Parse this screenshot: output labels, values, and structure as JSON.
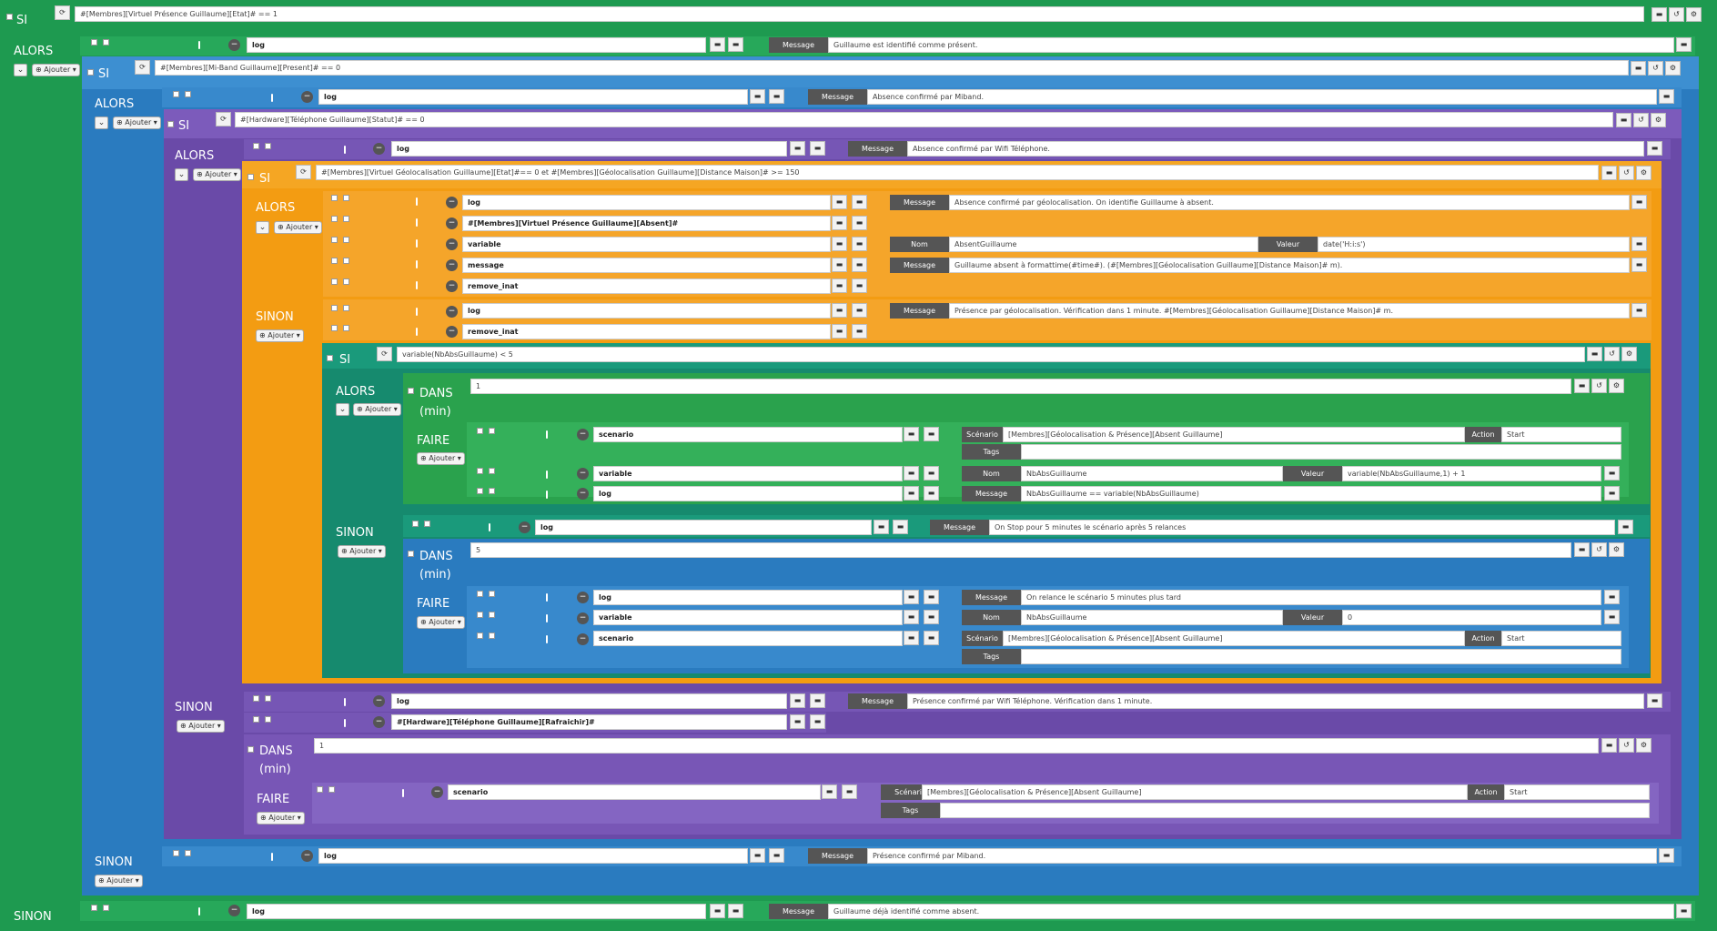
{
  "si": "SI",
  "alors": "ALORS",
  "sinon": "SINON",
  "dans": "DANS",
  "min": "(min)",
  "faire": "FAIRE",
  "ajouter": "Ajouter",
  "lbl_message": "Message",
  "lbl_nom": "Nom",
  "lbl_valeur": "Valeur",
  "lbl_scenario": "Scénario",
  "lbl_action": "Action",
  "lbl_tags": "Tags",
  "colors": {
    "green": "#1e9a50",
    "blue": "#2a7bbf",
    "purple": "#6a4aa8",
    "orange": "#f39c12",
    "teal": "#168a6e",
    "green2": "#2aa24d"
  },
  "icons": [
    "refresh-icon",
    "minus-circle-icon",
    "drag-handle-icon",
    "comment-icon",
    "copy-icon",
    "undo-icon",
    "settings-icon",
    "chevron-down-icon",
    "caret-down-icon"
  ],
  "c1": {
    "cond": "#[Membres][Virtuel Présence Guillaume][Etat]# == 1",
    "a1_cmd": "log",
    "a1_msg": "Guillaume est identifié comme présent.",
    "sinon_cmd": "log",
    "sinon_msg": "Guillaume déjà identifié comme absent."
  },
  "c2": {
    "cond": "#[Membres][Mi-Band Guillaume][Present]# == 0",
    "a1_cmd": "log",
    "a1_msg": "Absence confirmé par Miband.",
    "sinon_cmd": "log",
    "sinon_msg": "Présence confirmé par Miband."
  },
  "c3": {
    "cond": "#[Hardware][Téléphone Guillaume][Statut]# == 0",
    "a1_cmd": "log",
    "a1_msg": "Absence confirmé par Wifi Téléphone.",
    "s1_cmd": "log",
    "s1_msg": "Présence confirmé par Wifi Téléphone. Vérification dans 1 minute.",
    "s2_cmd": "#[Hardware][Téléphone Guillaume][Rafraichir]#",
    "dans": "1",
    "f_cmd": "scenario",
    "f_scen": "[Membres][Géolocalisation & Présence][Absent Guillaume]",
    "f_action": "Start"
  },
  "c4": {
    "cond": "#[Membres][Virtuel Géolocalisation Guillaume][Etat]#== 0 et #[Membres][Géolocalisation Guillaume][Distance Maison]# >= 150",
    "a1_cmd": "log",
    "a1_msg": "Absence confirmé par géolocalisation. On identifie Guillaume à absent.",
    "a2_cmd": "#[Membres][Virtuel Présence Guillaume][Absent]#",
    "a3_cmd": "variable",
    "a3_nom": "AbsentGuillaume",
    "a3_val": "date('H:i:s')",
    "a4_cmd": "message",
    "a4_msg": "Guillaume absent à formattime(#time#). (#[Membres][Géolocalisation Guillaume][Distance Maison]# m).",
    "a5_cmd": "remove_inat",
    "s1_cmd": "log",
    "s1_msg": "Présence par géolocalisation. Vérification dans 1 minute. #[Membres][Géolocalisation Guillaume][Distance Maison]# m.",
    "s2_cmd": "remove_inat"
  },
  "c5": {
    "cond": "variable(NbAbsGuillaume) < 5",
    "dans1": "1",
    "f1_cmd": "scenario",
    "f1_scen": "[Membres][Géolocalisation & Présence][Absent Guillaume]",
    "f1_action": "Start",
    "f2_cmd": "variable",
    "f2_nom": "NbAbsGuillaume",
    "f2_val": "variable(NbAbsGuillaume,1) + 1",
    "f3_cmd": "log",
    "f3_msg": "NbAbsGuillaume == variable(NbAbsGuillaume)",
    "s_cmd": "log",
    "s_msg": "On Stop pour 5 minutes le scénario après 5 relances",
    "dans2": "5",
    "g1_cmd": "log",
    "g1_msg": "On relance le scénario 5 minutes plus tard",
    "g2_cmd": "variable",
    "g2_nom": "NbAbsGuillaume",
    "g2_val": "0",
    "g3_cmd": "scenario",
    "g3_scen": "[Membres][Géolocalisation & Présence][Absent Guillaume]",
    "g3_action": "Start"
  }
}
